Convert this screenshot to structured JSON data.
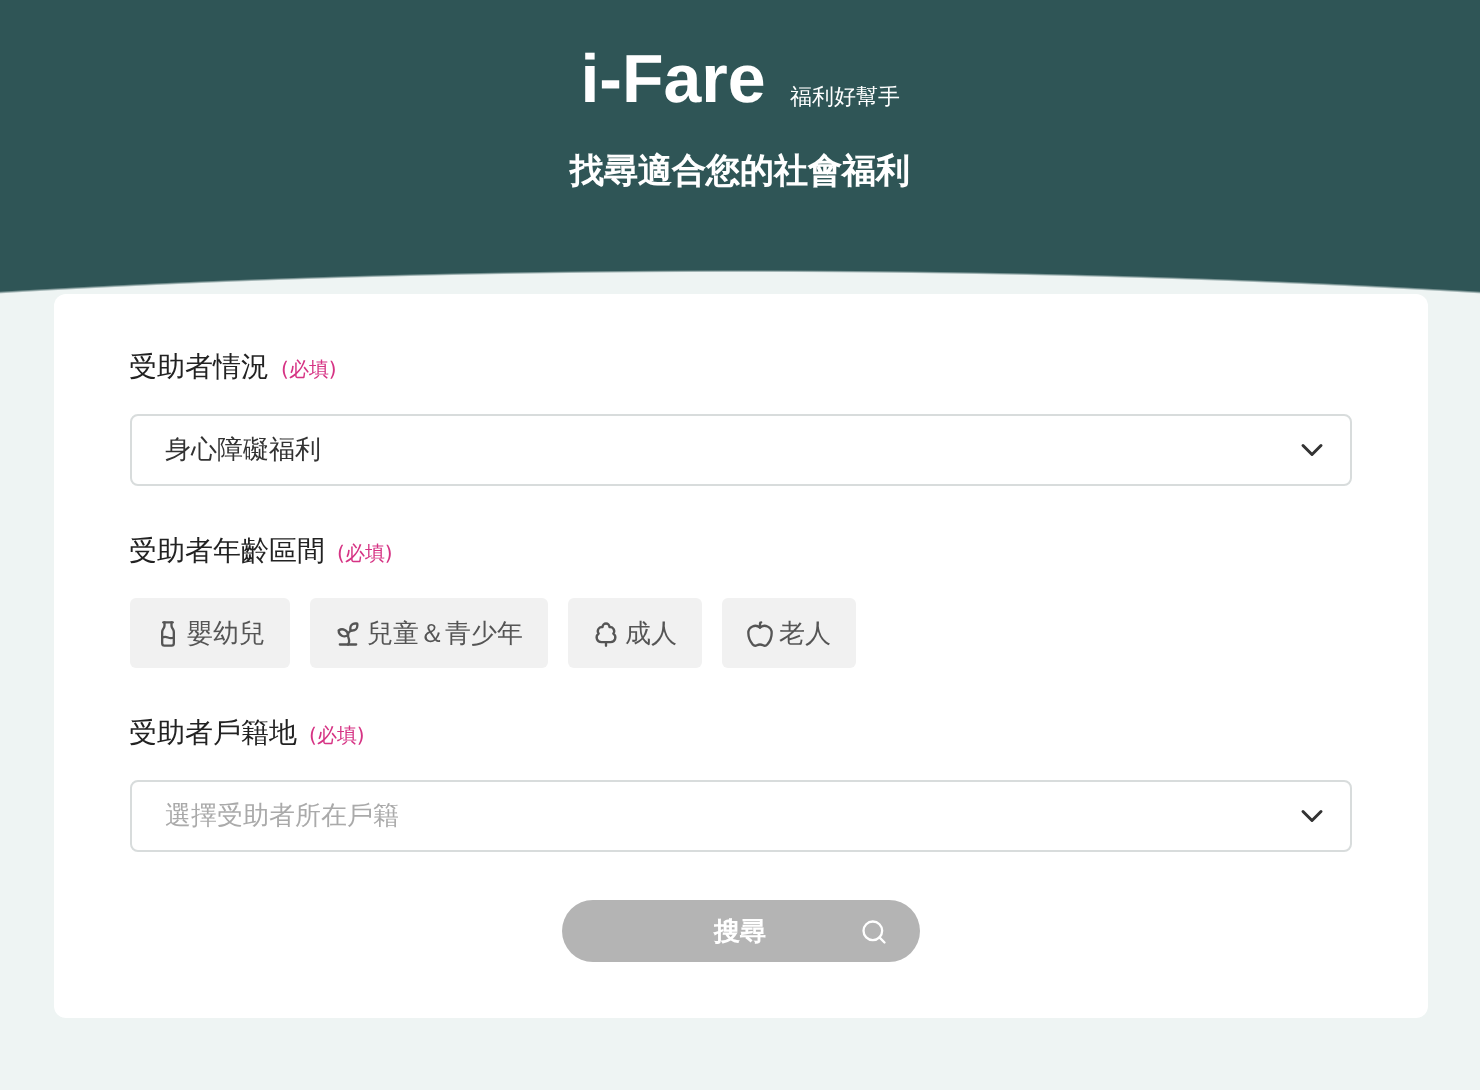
{
  "header": {
    "logo": "i-Fare",
    "tagline": "福利好幫手",
    "title": "找尋適合您的社會福利"
  },
  "form": {
    "fields": [
      {
        "kind": "select",
        "label": "受助者情況",
        "required": "(必填)",
        "value": "身心障礙福利"
      },
      {
        "kind": "chips",
        "label": "受助者年齡區間",
        "required": "(必填)",
        "options": [
          {
            "label": "嬰幼兒",
            "selected": false
          },
          {
            "label": "兒童＆青少年",
            "selected": false
          },
          {
            "label": "成人",
            "selected": false
          },
          {
            "label": "老人",
            "selected": false
          }
        ]
      },
      {
        "kind": "select",
        "label": "受助者戶籍地",
        "required": "(必填)",
        "placeholder": "選擇受助者所在戶籍"
      }
    ],
    "submit": {
      "label": "搜尋",
      "disabled": true
    }
  }
}
